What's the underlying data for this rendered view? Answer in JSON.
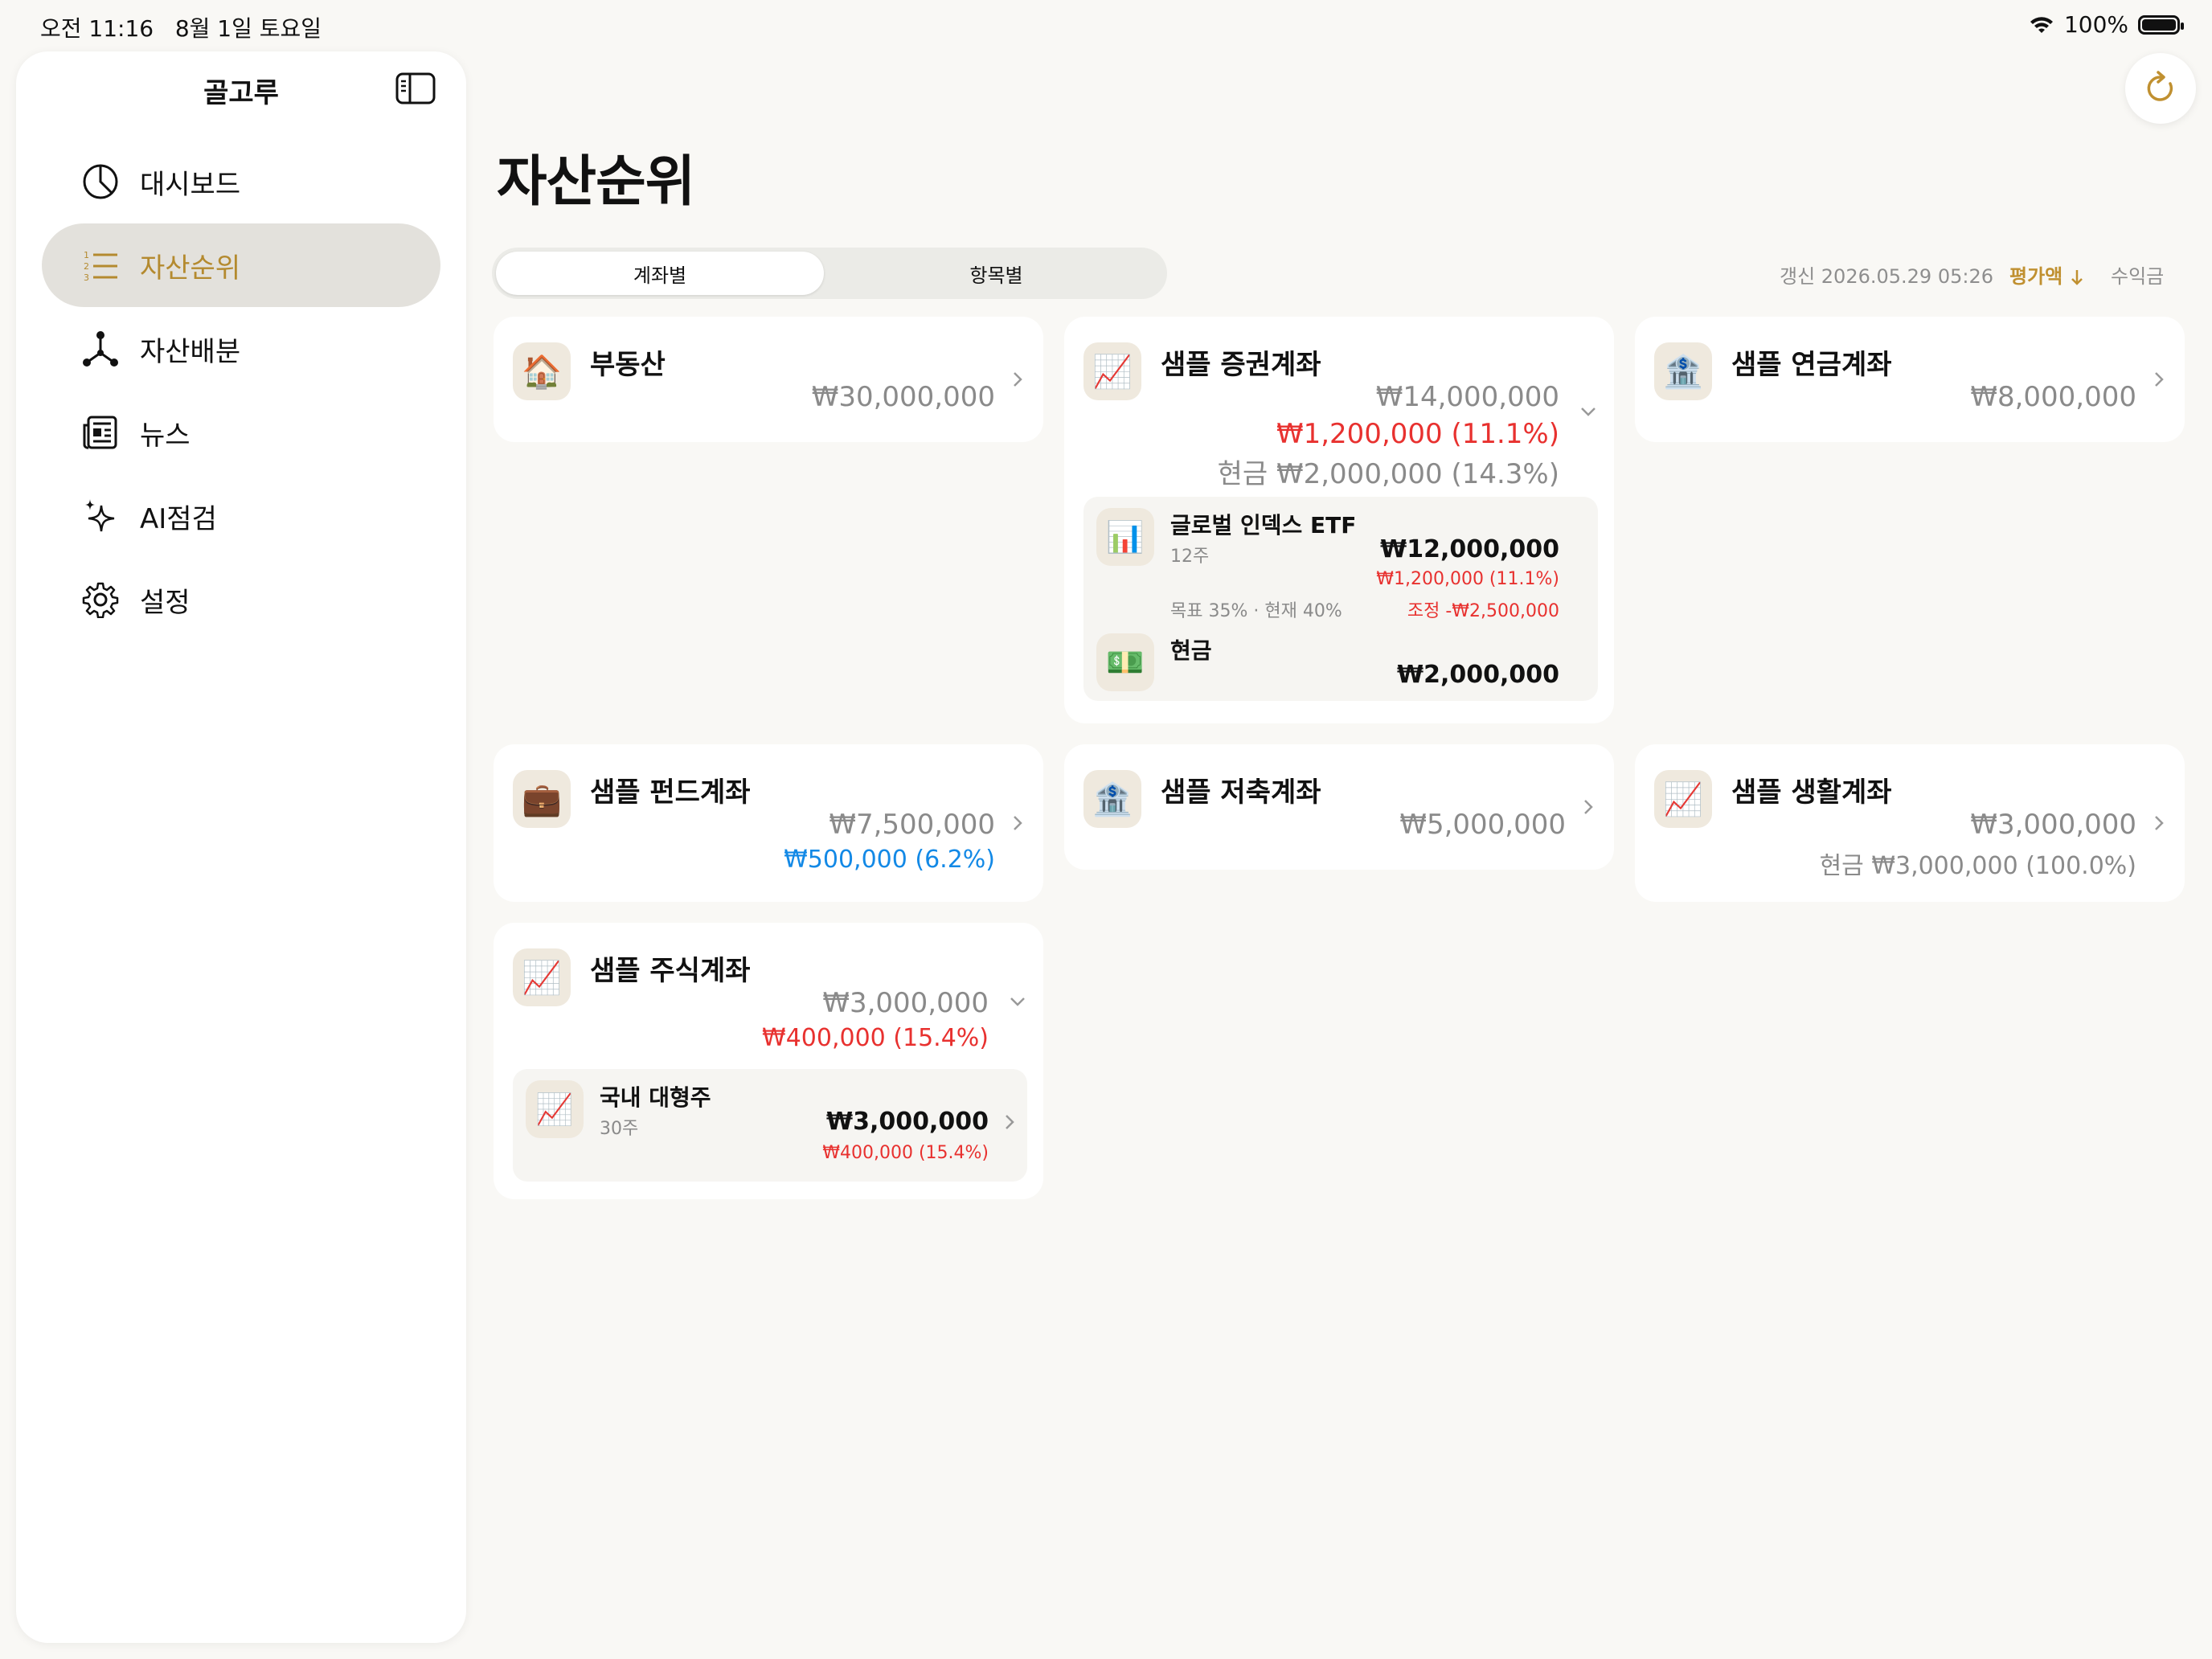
{
  "status": {
    "time": "오전 11:16",
    "date": "8월 1일 토요일",
    "battery": "100%"
  },
  "sidebar": {
    "title": "골고루",
    "items": [
      {
        "label": "대시보드",
        "icon": "pie-chart-icon"
      },
      {
        "label": "자산순위",
        "icon": "numbered-list-icon",
        "active": true
      },
      {
        "label": "자산배분",
        "icon": "network-icon"
      },
      {
        "label": "뉴스",
        "icon": "newspaper-icon"
      },
      {
        "label": "AI점검",
        "icon": "sparkles-icon"
      },
      {
        "label": "설정",
        "icon": "gear-icon"
      }
    ]
  },
  "main": {
    "title": "자산순위",
    "tabs": [
      {
        "label": "계좌별",
        "active": true
      },
      {
        "label": "항목별"
      }
    ],
    "updated": "갱신 2026.05.29 05:26",
    "sort_value": "평가액",
    "sort_profit": "수익금"
  },
  "cards": {
    "realestate": {
      "name": "부동산",
      "amount": "₩30,000,000",
      "icon": "house-icon"
    },
    "securities": {
      "name": "샘플 증권계좌",
      "amount": "₩14,000,000",
      "profit": "₩1,200,000 (11.1%)",
      "cash": "현금 ₩2,000,000 (14.3%)",
      "icon": "chart-up-icon",
      "holdings": [
        {
          "name": "글로벌 인덱스 ETF",
          "shares": "12주",
          "amount": "₩12,000,000",
          "profit": "₩1,200,000 (11.1%)",
          "target": "목표 35% · 현재 40%",
          "adjust": "조정 -₩2,500,000",
          "icon": "bar-chart-icon"
        },
        {
          "name": "현금",
          "amount": "₩2,000,000",
          "icon": "banknote-icon"
        }
      ]
    },
    "pension": {
      "name": "샘플 연금계좌",
      "amount": "₩8,000,000",
      "icon": "bank-icon"
    },
    "fund": {
      "name": "샘플 펀드계좌",
      "amount": "₩7,500,000",
      "profit": "₩500,000 (6.2%)",
      "icon": "briefcase-icon"
    },
    "savings": {
      "name": "샘플 저축계좌",
      "amount": "₩5,000,000",
      "icon": "bank-icon"
    },
    "living": {
      "name": "샘플 생활계좌",
      "amount": "₩3,000,000",
      "cash": "현금 ₩3,000,000 (100.0%)",
      "icon": "chart-up-icon"
    },
    "stock": {
      "name": "샘플 주식계좌",
      "amount": "₩3,000,000",
      "profit": "₩400,000 (15.4%)",
      "icon": "chart-up-icon",
      "holdings": [
        {
          "name": "국내 대형주",
          "shares": "30주",
          "amount": "₩3,000,000",
          "profit": "₩400,000 (15.4%)",
          "icon": "chart-up-icon"
        }
      ]
    }
  },
  "colors": {
    "accent": "#b48a2f",
    "loss_red": "#e8312f",
    "gain_blue": "#1389e6"
  }
}
